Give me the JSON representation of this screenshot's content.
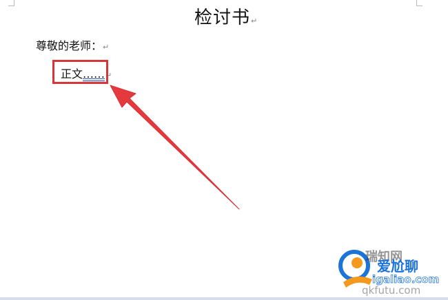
{
  "document": {
    "title": "检讨书",
    "salutation": "尊敬的老师：",
    "body_text": "正文",
    "body_ellipsis": "……",
    "paragraph_mark": "↵"
  },
  "watermark": {
    "line_top": "瑞知网",
    "brand": "爱尬聊",
    "domain": "igaliao.com",
    "domain_secondary": "qkfutu.com"
  },
  "colors": {
    "highlight": "#d8353b",
    "arrow": "#e4393f",
    "brand_blue": "#1d74d8",
    "brand_orange": "#f39a1e"
  }
}
